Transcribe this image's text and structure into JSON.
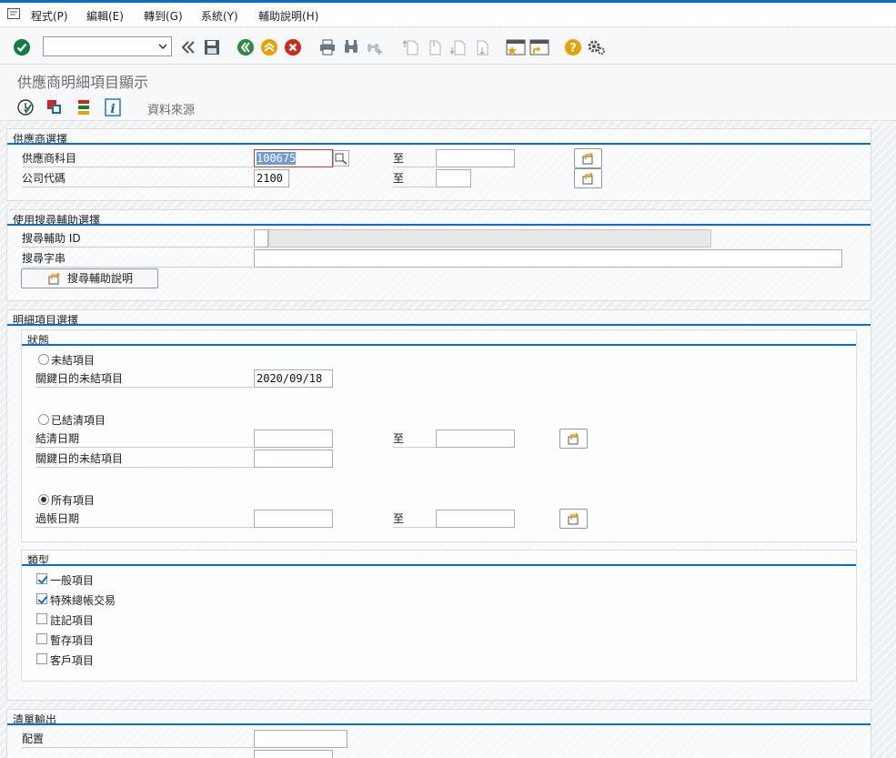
{
  "menu": {
    "items": [
      {
        "label": "程式(P)"
      },
      {
        "label": "編輯(E)"
      },
      {
        "label": "轉到(G)"
      },
      {
        "label": "系統(Y)"
      },
      {
        "label": "輔助說明(H)"
      }
    ]
  },
  "toolbar": {
    "command_field_value": "",
    "icons": [
      "enter-icon",
      "command-history-icon",
      "save-icon",
      "back-icon",
      "exit-icon",
      "cancel-icon",
      "print-icon",
      "find-icon",
      "find-next-icon",
      "first-page-icon",
      "previous-page-icon",
      "next-page-icon",
      "last-page-icon",
      "new-session-icon",
      "shortcut-icon",
      "help-icon",
      "settings-icon"
    ]
  },
  "page": {
    "title": "供應商明細項目顯示"
  },
  "app_toolbar": {
    "icons": [
      "execute-icon",
      "get-variant-icon",
      "selection-options-icon",
      "info-icon"
    ],
    "data_source_label": "資料來源"
  },
  "vendor_selection": {
    "title": "供應商選擇",
    "vendor_account_label": "供應商科目",
    "vendor_account_value": "100675",
    "company_code_label": "公司代碼",
    "company_code_value": "2100",
    "to_label": "至",
    "to_label_2": "至"
  },
  "search_help": {
    "title": "使用搜尋輔助選擇",
    "search_help_id_label": "搜尋輔助 ID",
    "search_string_label": "搜尋字串",
    "search_help_button": "搜尋輔助說明"
  },
  "line_item_selection": {
    "title": "明細項目選擇",
    "status": {
      "title": "狀態",
      "open_items_label": "未結項目",
      "open_key_date_label": "關鍵日的未結項目",
      "open_key_date_value": "2020/09/18",
      "cleared_items_label": "已結清項目",
      "clearing_date_label": "結清日期",
      "cleared_key_date_label": "關鍵日的未結項目",
      "all_items_label": "所有項目",
      "posting_date_label": "過帳日期",
      "to_label": "至",
      "to_label_2": "至",
      "selected": "all_items"
    },
    "type": {
      "title": "類型",
      "items": [
        {
          "label": "一般項目",
          "checked": true
        },
        {
          "label": "特殊總帳交易",
          "checked": true
        },
        {
          "label": "註記項目",
          "checked": false
        },
        {
          "label": "暫存項目",
          "checked": false
        },
        {
          "label": "客戶項目",
          "checked": false
        }
      ]
    }
  },
  "list_output": {
    "title": "清單輸出",
    "layout_label": "配置"
  },
  "colors": {
    "accent_blue": "#0a6ed1",
    "enter_green": "#107e3e",
    "back_green": "#2b8a3e",
    "exit_yellow": "#e9a100",
    "cancel_red": "#d0271d",
    "help_yellow": "#e9a100"
  }
}
